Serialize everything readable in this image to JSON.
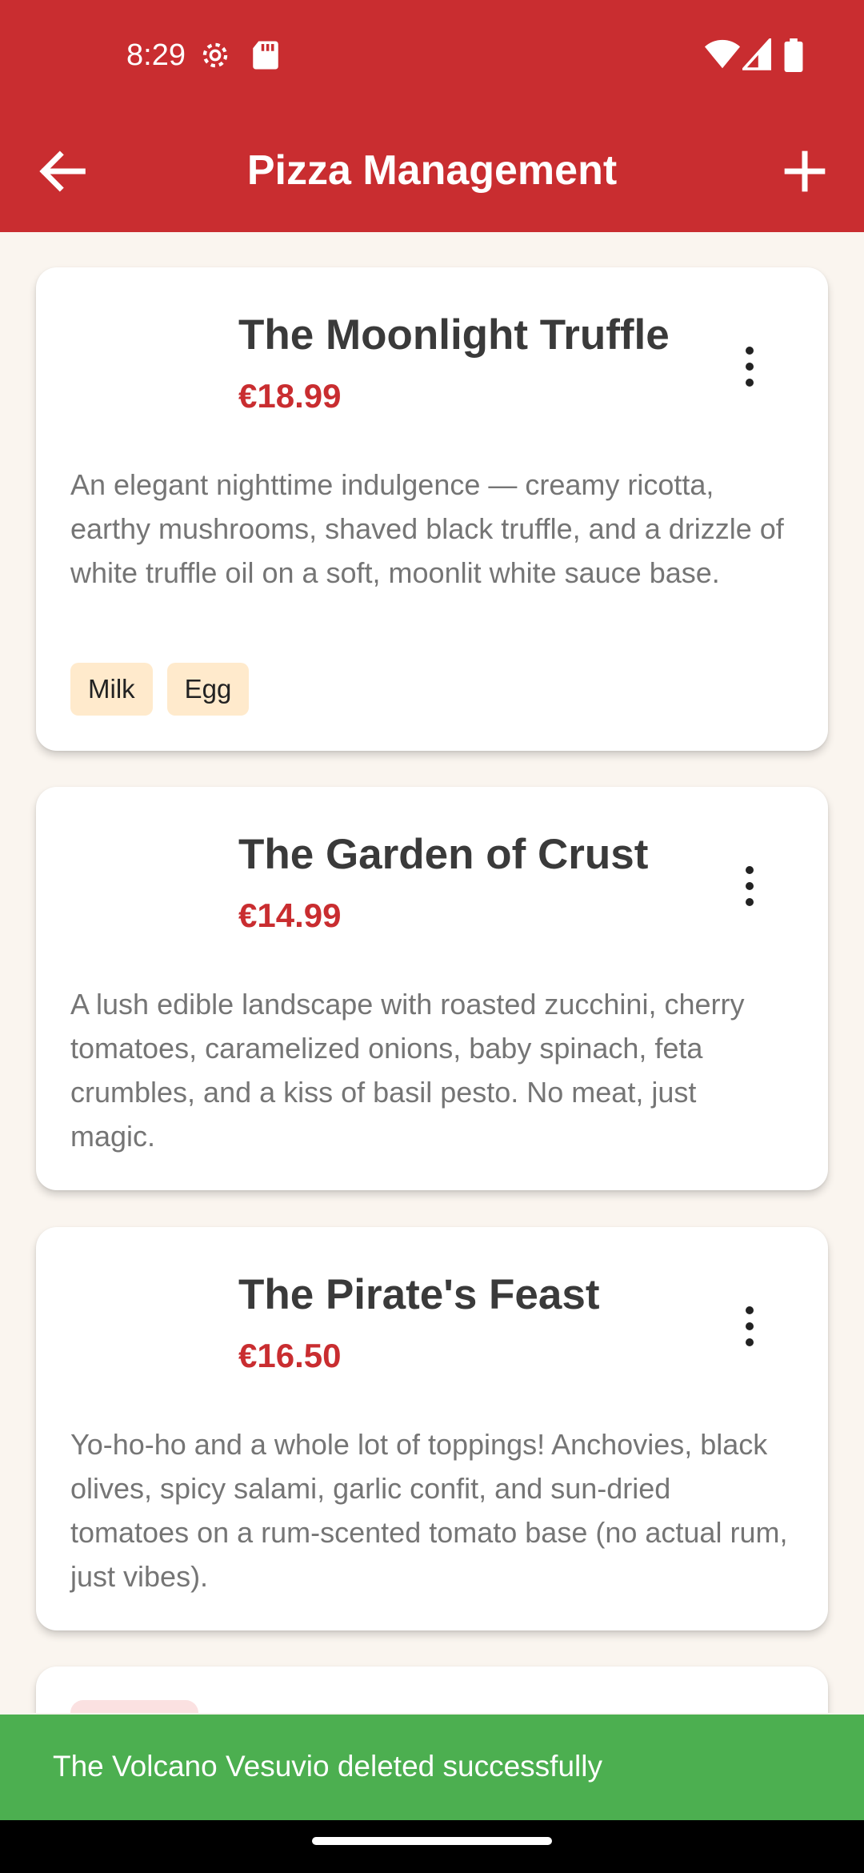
{
  "status_bar": {
    "time": "8:29",
    "icons": [
      "settings-icon",
      "sd-card-icon",
      "wifi-icon",
      "signal-icon",
      "battery-icon"
    ]
  },
  "app_bar": {
    "title": "Pizza Management",
    "back_icon": "arrow-back-icon",
    "add_icon": "add-icon"
  },
  "colors": {
    "primary": "#c92d30",
    "background": "#faf5ef",
    "tag": "#ffeacc",
    "snackbar": "#4caf50"
  },
  "pizzas": [
    {
      "name": "The Moonlight Truffle",
      "price": "€18.99",
      "description": "An elegant nighttime indulgence — creamy ricotta, earthy mushrooms, shaved black truffle, and a drizzle of white truffle oil on a soft, moonlit white sauce base.",
      "allergens": [
        "Milk",
        "Egg"
      ]
    },
    {
      "name": "The Garden of Crust",
      "price": "€14.99",
      "description": "A lush edible landscape with roasted zucchini, cherry tomatoes, caramelized onions, baby spinach, feta crumbles, and a kiss of basil pesto. No meat, just magic.",
      "allergens": []
    },
    {
      "name": "The Pirate's Feast",
      "price": "€16.50",
      "description": "Yo-ho-ho and a whole lot of toppings! Anchovies, black olives, spicy salami, garlic confit, and sun-dried tomatoes on a rum-scented tomato base (no actual rum, just vibes).",
      "allergens": []
    }
  ],
  "snackbar": {
    "message": "The Volcano Vesuvio deleted successfully"
  }
}
